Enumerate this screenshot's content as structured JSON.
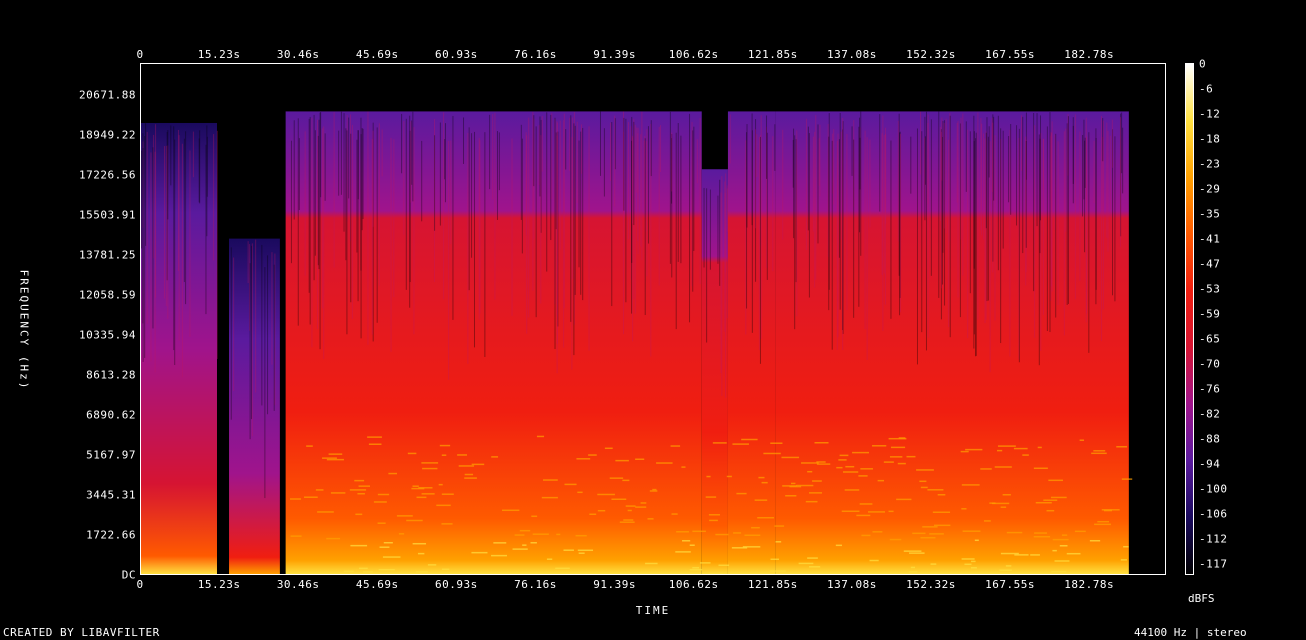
{
  "chart_data": {
    "type": "heatmap",
    "title": "",
    "xlabel": "TIME",
    "ylabel": "FREQUENCY (Hz)",
    "x_ticks": [
      "0",
      "15.23s",
      "30.46s",
      "45.69s",
      "60.93s",
      "76.16s",
      "91.39s",
      "106.62s",
      "121.85s",
      "137.08s",
      "152.32s",
      "167.55s",
      "182.78s"
    ],
    "y_ticks": [
      "DC",
      "1722.66",
      "3445.31",
      "5167.97",
      "6890.62",
      "8613.28",
      "10335.94",
      "12058.59",
      "13781.25",
      "15503.91",
      "17226.56",
      "18949.22",
      "20671.88"
    ],
    "colorbar_label": "dBFS",
    "colorbar_ticks": [
      "0",
      "-6",
      "-12",
      "-18",
      "-23",
      "-29",
      "-35",
      "-41",
      "-47",
      "-53",
      "-59",
      "-65",
      "-70",
      "-76",
      "-82",
      "-88",
      "-94",
      "-100",
      "-106",
      "-112",
      "-117"
    ],
    "xlim": [
      0,
      195.4
    ],
    "ylim": [
      0,
      22050
    ],
    "colormap": [
      "#000000",
      "#1a0a5e",
      "#5a1a9e",
      "#a0148c",
      "#d61432",
      "#f01e10",
      "#ff5a00",
      "#ffa000",
      "#ffe040",
      "#ffffff"
    ],
    "segments": [
      {
        "t_start": 0,
        "t_end": 14.5,
        "cutoff_hz": 19500,
        "level": "mid"
      },
      {
        "t_start": 14.5,
        "t_end": 16.8,
        "cutoff_hz": 0,
        "level": "silent"
      },
      {
        "t_start": 16.8,
        "t_end": 26.5,
        "cutoff_hz": 14500,
        "level": "low"
      },
      {
        "t_start": 26.5,
        "t_end": 27.6,
        "cutoff_hz": 0,
        "level": "silent"
      },
      {
        "t_start": 27.6,
        "t_end": 107,
        "cutoff_hz": 20000,
        "level": "high"
      },
      {
        "t_start": 107,
        "t_end": 112,
        "cutoff_hz": 17500,
        "level": "high"
      },
      {
        "t_start": 112,
        "t_end": 121,
        "cutoff_hz": 20000,
        "level": "high"
      },
      {
        "t_start": 121,
        "t_end": 188.5,
        "cutoff_hz": 20000,
        "level": "high"
      },
      {
        "t_start": 188.5,
        "t_end": 195.4,
        "cutoff_hz": 0,
        "level": "silent"
      }
    ],
    "energy_rolloff_hz": 15700
  },
  "footer": {
    "credit": "CREATED BY LIBAVFILTER",
    "info": "44100 Hz | stereo"
  }
}
